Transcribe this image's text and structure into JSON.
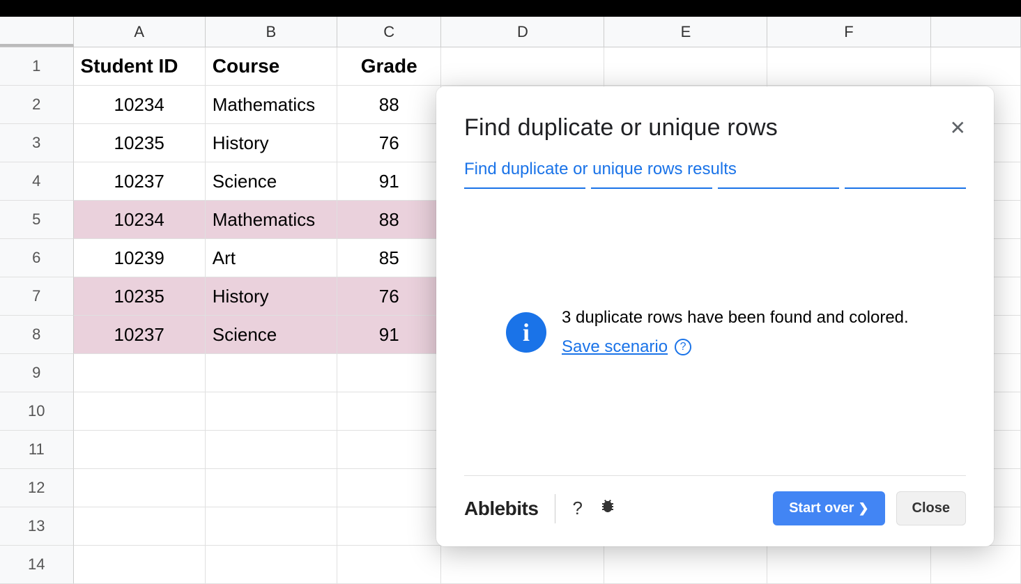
{
  "columns": [
    "A",
    "B",
    "C",
    "D",
    "E",
    "F"
  ],
  "sheet": {
    "headers": {
      "A": "Student ID",
      "B": "Course",
      "C": "Grade"
    },
    "rows": [
      {
        "num": 1,
        "isHeader": true
      },
      {
        "num": 2,
        "A": "10234",
        "B": "Mathematics",
        "C": "88",
        "highlight": false
      },
      {
        "num": 3,
        "A": "10235",
        "B": "History",
        "C": "76",
        "highlight": false
      },
      {
        "num": 4,
        "A": "10237",
        "B": "Science",
        "C": "91",
        "highlight": false
      },
      {
        "num": 5,
        "A": "10234",
        "B": "Mathematics",
        "C": "88",
        "highlight": true
      },
      {
        "num": 6,
        "A": "10239",
        "B": "Art",
        "C": "85",
        "highlight": false
      },
      {
        "num": 7,
        "A": "10235",
        "B": "History",
        "C": "76",
        "highlight": true
      },
      {
        "num": 8,
        "A": "10237",
        "B": "Science",
        "C": "91",
        "highlight": true
      },
      {
        "num": 9
      },
      {
        "num": 10
      },
      {
        "num": 11
      },
      {
        "num": 12
      },
      {
        "num": 13
      },
      {
        "num": 14
      }
    ]
  },
  "dialog": {
    "title": "Find duplicate or unique rows",
    "subtitle": "Find duplicate or unique rows results",
    "result_msg": "3 duplicate rows have been found and colored.",
    "save_link": "Save scenario",
    "brand": "Ablebits",
    "start_over": "Start over",
    "close": "Close"
  }
}
